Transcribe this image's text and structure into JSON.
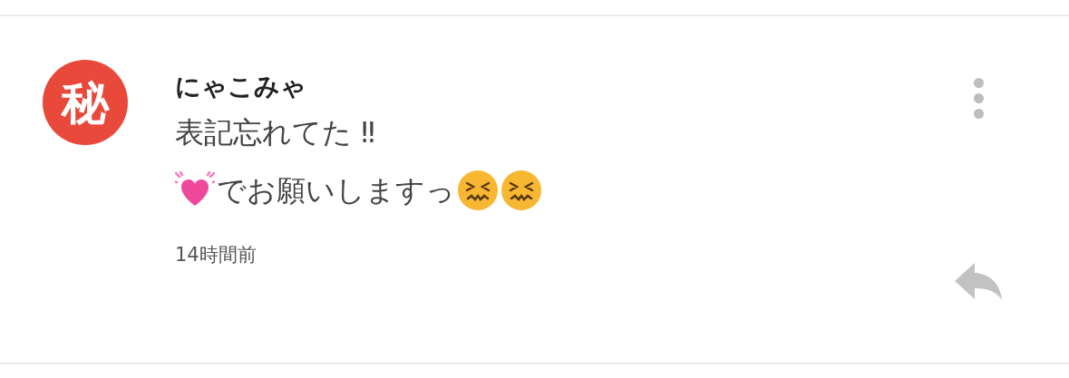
{
  "comment": {
    "avatar": {
      "text": "秘"
    },
    "author": "にゃこみゃ",
    "lines": [
      [
        {
          "kind": "text",
          "text": "表記忘れてた ‼"
        }
      ],
      [
        {
          "kind": "heart"
        },
        {
          "kind": "text",
          "text": "でお願いしますっ"
        },
        {
          "kind": "face"
        },
        {
          "kind": "face"
        }
      ]
    ],
    "time": "14時間前"
  }
}
